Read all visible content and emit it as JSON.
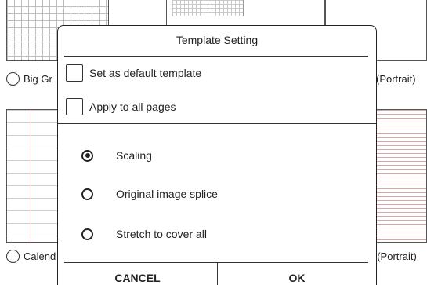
{
  "background": {
    "top_left_label": "Big Gr",
    "top_right_label": "(Portrait)",
    "bottom_left_label": "Calend",
    "bottom_right_label": "h(Portrait)"
  },
  "dialog": {
    "title": "Template Setting",
    "checkboxes": [
      {
        "label": "Set as default template",
        "checked": false
      },
      {
        "label": "Apply to all pages",
        "checked": false
      }
    ],
    "options": [
      {
        "label": "Scaling",
        "selected": true
      },
      {
        "label": "Original image splice",
        "selected": false
      },
      {
        "label": "Stretch to cover all",
        "selected": false
      }
    ],
    "cancel_label": "CANCEL",
    "ok_label": "OK"
  }
}
